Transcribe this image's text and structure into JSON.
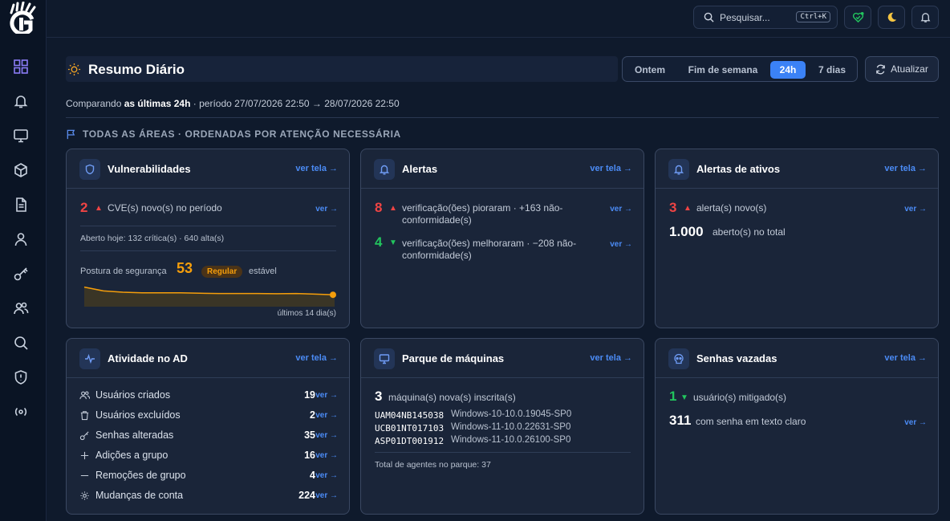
{
  "topbar": {
    "search_placeholder": "Pesquisar...",
    "search_shortcut": "Ctrl+K"
  },
  "header": {
    "title": "Resumo Diário",
    "periods": [
      "Ontem",
      "Fim de semana",
      "24h",
      "7 dias"
    ],
    "active_period": "24h",
    "refresh_label": "Atualizar"
  },
  "compare": {
    "prefix": "Comparando",
    "strong": "as últimas 24h",
    "suffix": "· período 27/07/2026 22:50 → 28/07/2026 22:50"
  },
  "section_title": "TODAS AS ÁREAS · ORDENADAS POR ATENÇÃO NECESSÁRIA",
  "ver_tela": "ver tela →",
  "ver": "ver →",
  "vuln": {
    "title": "Vulnerabilidades",
    "count": "2",
    "count_desc": "CVE(s) novo(s) no período",
    "open_today": "Aberto hoje: 132 crítica(s) · 640 alta(s)",
    "posture_label": "Postura de segurança",
    "posture_value": "53",
    "posture_badge": "Regular",
    "posture_trend": "estável",
    "sparkline_caption": "últimos 14 dia(s)",
    "sparkline": [
      59,
      56,
      55,
      54.5,
      54.5,
      54.5,
      54.2,
      54,
      54,
      54,
      53.8,
      54,
      53.5,
      53
    ]
  },
  "alerts": {
    "title": "Alertas",
    "worse_count": "8",
    "worse_desc": "verificação(ões) pioraram · +163 não-conformidade(s)",
    "better_count": "4",
    "better_desc": "verificação(ões) melhoraram · −208 não-conformidade(s)"
  },
  "asset_alerts": {
    "title": "Alertas de ativos",
    "new_count": "3",
    "new_desc": "alerta(s) novo(s)",
    "open_count": "1.000",
    "open_desc": "aberto(s) no total"
  },
  "ad": {
    "title": "Atividade no AD",
    "rows": [
      {
        "label": "Usuários criados",
        "value": "19"
      },
      {
        "label": "Usuários excluídos",
        "value": "2"
      },
      {
        "label": "Senhas alteradas",
        "value": "35"
      },
      {
        "label": "Adições a grupo",
        "value": "16"
      },
      {
        "label": "Remoções de grupo",
        "value": "4"
      },
      {
        "label": "Mudanças de conta",
        "value": "224"
      }
    ]
  },
  "machines": {
    "title": "Parque de máquinas",
    "new_count": "3",
    "new_desc": "máquina(s) nova(s) inscrita(s)",
    "list": [
      {
        "host": "UAM04NB145038",
        "os": "Windows-10-10.0.19045-SP0"
      },
      {
        "host": "UCB01NT017103",
        "os": "Windows-11-10.0.22631-SP0"
      },
      {
        "host": "ASP01DT001912",
        "os": "Windows-11-10.0.26100-SP0"
      }
    ],
    "total": "Total de agentes no parque: 37"
  },
  "leaks": {
    "title": "Senhas vazadas",
    "mitigated_count": "1",
    "mitigated_desc": "usuário(s) mitigado(s)",
    "clear_count": "311",
    "clear_desc": "com senha em texto claro"
  },
  "colors": {
    "accent": "#3b82f6",
    "danger": "#ef4444",
    "success": "#22c55e",
    "warning": "#f59e0b"
  }
}
